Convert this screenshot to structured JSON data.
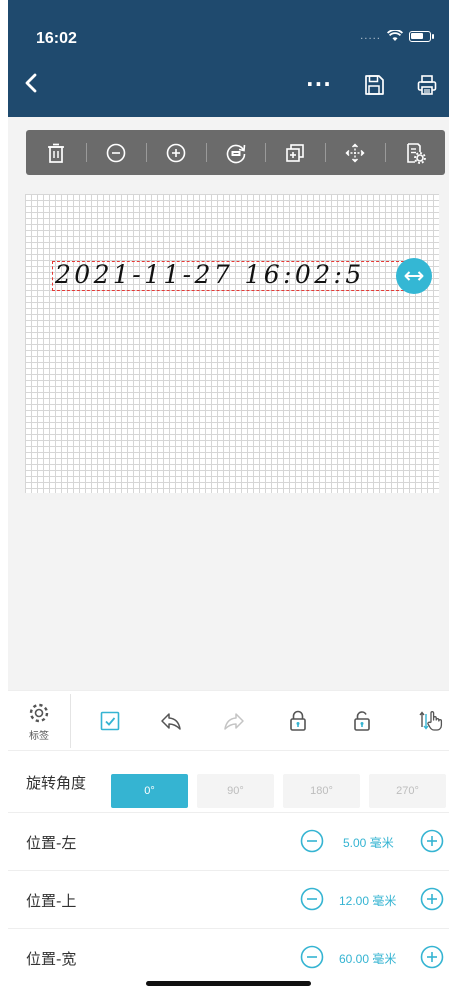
{
  "status_bar": {
    "time": "16:02",
    "signal": "....."
  },
  "nav": {
    "more_label": "···"
  },
  "canvas": {
    "label_text": "2021-11-27 16:02:5"
  },
  "bottom_toolbar": {
    "tag_label": "标签"
  },
  "rotation": {
    "label": "旋转角度",
    "options": [
      "0°",
      "90°",
      "180°",
      "270°"
    ],
    "selected": "0°"
  },
  "properties": [
    {
      "label": "位置-左",
      "value": "5.00 毫米"
    },
    {
      "label": "位置-上",
      "value": "12.00 毫米"
    },
    {
      "label": "位置-宽",
      "value": "60.00 毫米"
    }
  ],
  "colors": {
    "header": "#1f4a6e",
    "accent": "#35b4d2",
    "selection": "#e53935",
    "toolbar": "#6b6b6b"
  },
  "icons": [
    "back-icon",
    "more-icon",
    "save-icon",
    "print-icon",
    "trash-icon",
    "zoom-out-icon",
    "zoom-in-icon",
    "rotate-90-icon",
    "duplicate-icon",
    "move-icon",
    "settings-document-icon",
    "gear-icon",
    "checkbox-icon",
    "undo-icon",
    "redo-icon",
    "lock-icon",
    "unlock-icon",
    "sort-hand-icon",
    "minus-circle-icon",
    "plus-circle-icon",
    "resize-arrows-icon"
  ]
}
